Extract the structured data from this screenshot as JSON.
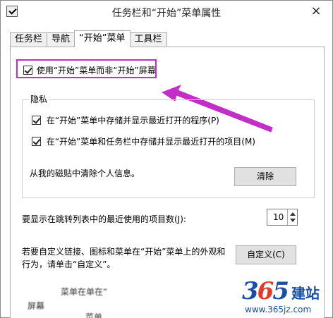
{
  "window": {
    "title": "任务栏和“开始”菜单属性",
    "close_glyph": "×"
  },
  "tabs": [
    {
      "label": "任务栏",
      "active": false
    },
    {
      "label": "导航",
      "active": false
    },
    {
      "label": "“开始”菜单",
      "active": true
    },
    {
      "label": "工具栏",
      "active": false
    }
  ],
  "start_screen_option": {
    "label": "使用“开始”菜单而非“开始”屏幕",
    "checked": true
  },
  "privacy": {
    "title": "隐私",
    "options": [
      {
        "label": "在“开始”菜单中存储并显示最近打开的程序(P)",
        "checked": true
      },
      {
        "label": "在“开始”菜单和任务栏中存储并显示最近打开的项目(M)",
        "checked": true
      }
    ],
    "tiles_text": "从我的磁贴中清除个人信息。",
    "clear_button": "清除"
  },
  "jumplist": {
    "label": "要显示在跳转列表中的最近使用的项目数(J):",
    "value": "10"
  },
  "customize": {
    "text_line1": "若要自定义链接、图标和菜单在“开始”菜单上的外观和",
    "text_line2": "行为，请单击“自定义”。",
    "button": "自定义(C)"
  },
  "obscured": {
    "line1": "菜单在单在“",
    "line2": "屏幕",
    "line3": "菜单"
  },
  "watermark": {
    "digits_a": "3",
    "digits_b": "6",
    "digits_c": "5",
    "cn": "建站",
    "url": "www.365jz.com"
  },
  "annotation": {
    "arrow_color": "#c22ec7"
  }
}
